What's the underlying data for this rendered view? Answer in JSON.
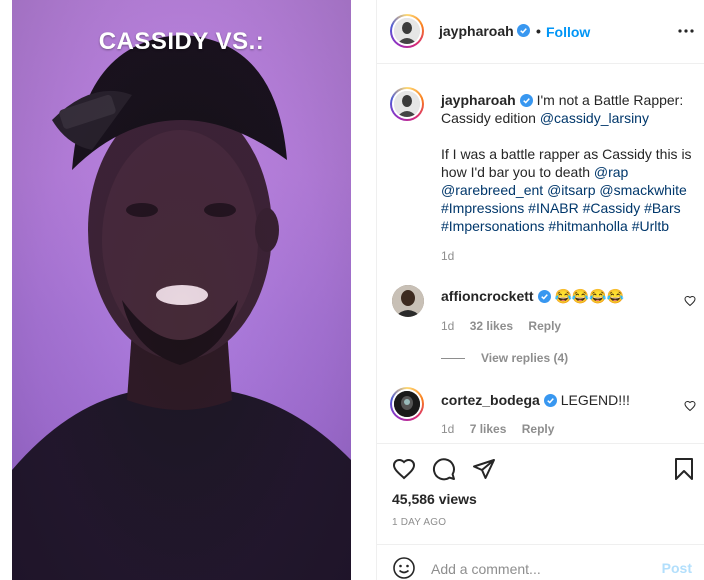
{
  "video": {
    "caption": "CASSIDY VS.:"
  },
  "header": {
    "username": "jaypharoah",
    "separator": "•",
    "follow_label": "Follow",
    "more_icon": "more-horizontal-icon"
  },
  "caption_comment": {
    "username": "jaypharoah",
    "text_1": "I'm not a Battle Rapper: Cassidy edition",
    "mention_1": "@cassidy_larsiny",
    "text_2": "If I was a battle rapper as Cassidy this is how I'd bar you to death",
    "tags": [
      "@rap",
      "@rarebreed_ent",
      "@itsarp",
      "@smackwhite",
      "#Impressions",
      "#INABR",
      "#Cassidy",
      "#Bars",
      "#Impersonations",
      "#hitmanholla",
      "#Urltb"
    ],
    "time": "1d"
  },
  "comments": [
    {
      "username": "affioncrockett",
      "text": "😂😂😂😂",
      "time": "1d",
      "likes": "32 likes",
      "reply": "Reply"
    },
    {
      "username": "cortez_bodega",
      "text": "LEGEND!!!",
      "time": "1d",
      "likes": "7 likes",
      "reply": "Reply"
    }
  ],
  "view_replies": "View replies (4)",
  "actions": {
    "views": "45,586 views",
    "time_ago": "1 DAY AGO"
  },
  "add_comment": {
    "placeholder": "Add a comment...",
    "post_label": "Post"
  },
  "colors": {
    "accent": "#0095f6",
    "link": "#00376b",
    "muted": "#8e8e8e",
    "post_disabled": "#b2dffc"
  }
}
